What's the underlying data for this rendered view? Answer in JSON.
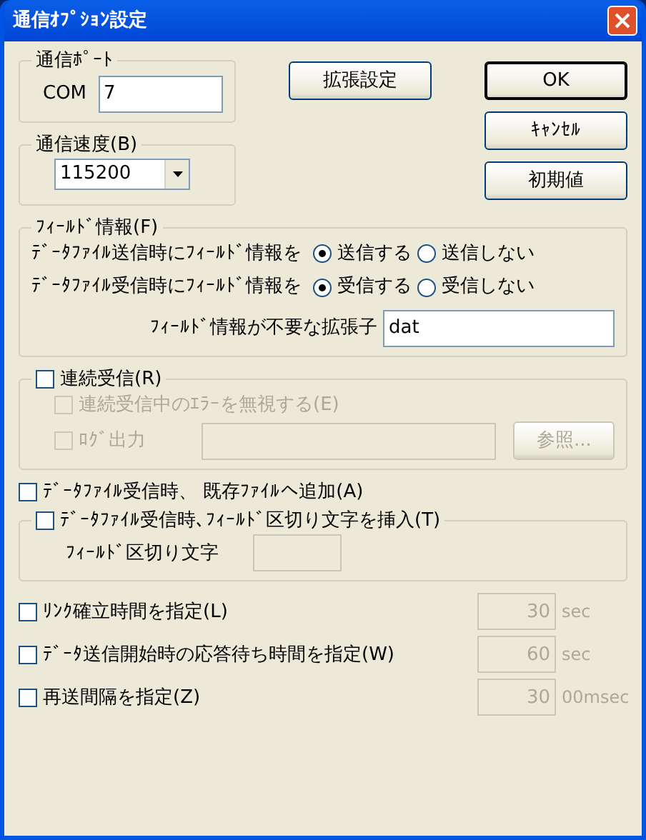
{
  "window": {
    "title": "通信ｵﾌﾟｼｮﾝ設定"
  },
  "port_group": {
    "label": "通信ﾎﾟｰﾄ",
    "com_label": "COM",
    "com_value": "7"
  },
  "speed_group": {
    "label": "通信速度(B)",
    "value": "115200"
  },
  "extended_button": "拡張設定",
  "side_buttons": [
    {
      "label": "OK",
      "default": true
    },
    {
      "label": "ｷｬﾝｾﾙ",
      "default": false
    },
    {
      "label": "初期値",
      "default": false
    }
  ],
  "field_info": {
    "label": "ﾌｨｰﾙﾄﾞ情報(F)",
    "rows": [
      {
        "label": "ﾃﾞｰﾀﾌｧｲﾙ送信時にﾌｨｰﾙﾄﾞ情報を",
        "options": [
          {
            "label": "送信する",
            "selected": true
          },
          {
            "label": "送信しない",
            "selected": false
          }
        ]
      },
      {
        "label": "ﾃﾞｰﾀﾌｧｲﾙ受信時にﾌｨｰﾙﾄﾞ情報を",
        "options": [
          {
            "label": "受信する",
            "selected": true
          },
          {
            "label": "受信しない",
            "selected": false
          }
        ]
      }
    ],
    "ext_label": "ﾌｨｰﾙﾄﾞ情報が不要な拡張子",
    "ext_value": "dat"
  },
  "continuous": {
    "label": "連続受信(R)",
    "checked": false,
    "items": [
      {
        "kind": "checkbox",
        "label": "連続受信中のｴﾗｰを無視する(E)",
        "checked": false,
        "disabled": true
      },
      {
        "kind": "file",
        "label": "ﾛｸﾞ出力",
        "checked": false,
        "disabled": true,
        "button": "参照..."
      }
    ]
  },
  "append": {
    "label": "ﾃﾞｰﾀﾌｧｲﾙ受信時、 既存ﾌｧｲﾙへ追加(A)",
    "checked": false
  },
  "separator": {
    "label": "ﾃﾞｰﾀﾌｧｲﾙ受信時､ﾌｨｰﾙﾄﾞ区切り文字を挿入(T)",
    "checked": false,
    "field_label": "ﾌｨｰﾙﾄﾞ区切り文字"
  },
  "timeouts": [
    {
      "label": "ﾘﾝｸ確立時間を指定(L)",
      "checked": false,
      "value": "30",
      "unit": "sec",
      "disabled": true
    },
    {
      "label": "ﾃﾞｰﾀ送信開始時の応答待ち時間を指定(W)",
      "checked": false,
      "value": "60",
      "unit": "sec",
      "disabled": true
    },
    {
      "label": "再送間隔を指定(Z)",
      "checked": false,
      "value": "30",
      "unit": "00msec",
      "disabled": true
    }
  ]
}
